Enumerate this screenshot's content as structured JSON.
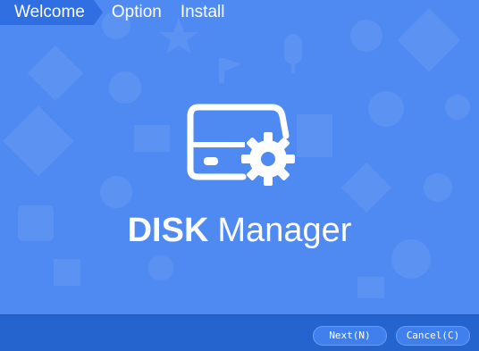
{
  "steps": {
    "welcome": "Welcome",
    "option": "Option",
    "install": "Install"
  },
  "brand": {
    "bold": "DISK",
    "light": "Manager"
  },
  "buttons": {
    "next": "Next(N)",
    "cancel": "Cancel(C)"
  },
  "colors": {
    "background": "#4f8af2",
    "active_step": "#2f6fe2",
    "bottom_bar": "#2563cf",
    "button": "#3f80ee",
    "text": "#ffffff"
  },
  "icons": [
    "disk-gear-logo-icon"
  ]
}
